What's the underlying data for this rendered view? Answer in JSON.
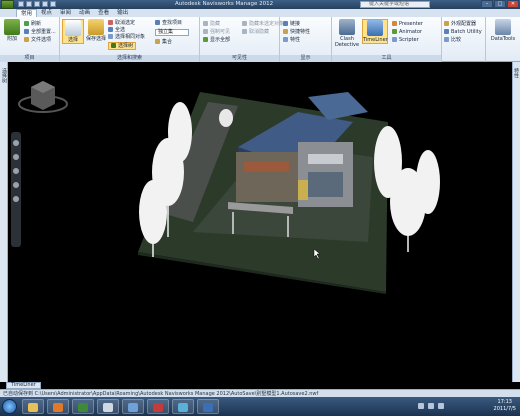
{
  "window": {
    "title": "Autodesk Navisworks Manage 2012",
    "search_placeholder": "键入关键字或短语",
    "controls": [
      "–",
      "□",
      "✕"
    ]
  },
  "ribbon_tabs": [
    "常用",
    "视点",
    "审阅",
    "动画",
    "查看",
    "输出"
  ],
  "ribbon": {
    "project": {
      "label": "项目",
      "big_button": "附加",
      "items": [
        "刷新",
        "全部重置...",
        "文件选项"
      ]
    },
    "select_search": {
      "label": "选择和搜索",
      "big_button": "选择",
      "big_button2": "保存选择",
      "items": [
        "取消选定",
        "全选",
        "选择相同对象",
        "选择树"
      ],
      "dropdown": "独立集",
      "items2": [
        "查找项目",
        "集合"
      ]
    },
    "visibility": {
      "label": "可见性",
      "items": [
        "隐藏",
        "强制可见",
        "显示全部"
      ],
      "items2": [
        "隐藏未选定对象",
        "取消隐藏"
      ]
    },
    "display": {
      "label": "显示",
      "items": [
        "链接",
        "快捷特性",
        "特性"
      ]
    },
    "tools": {
      "label": "工具",
      "big_buttons": [
        "Clash Detective",
        "TimeLiner"
      ],
      "items": [
        "Presenter",
        "Animator",
        "Scripter"
      ],
      "items2": [
        "外观配置器",
        "Batch Utility",
        "比较"
      ],
      "big_button3": "DataTools"
    }
  },
  "left_rail_label": "选择树",
  "right_rail_label": "特性",
  "bottom_tab": "TimeLiner",
  "status_text": "已自动保存到 C:\\Users\\Administrator\\AppData\\Roaming\\Autodesk Navisworks Manage 2012\\AutoSave\\别墅模型1.Autosave2.nwf",
  "taskbar": {
    "clock_time": "17:13",
    "clock_date": "2011/7/5"
  },
  "colors": {
    "accent_active": "#ffe38c",
    "ribbon_bg": "#eaf1f8",
    "viewport_bg": "#000000"
  }
}
